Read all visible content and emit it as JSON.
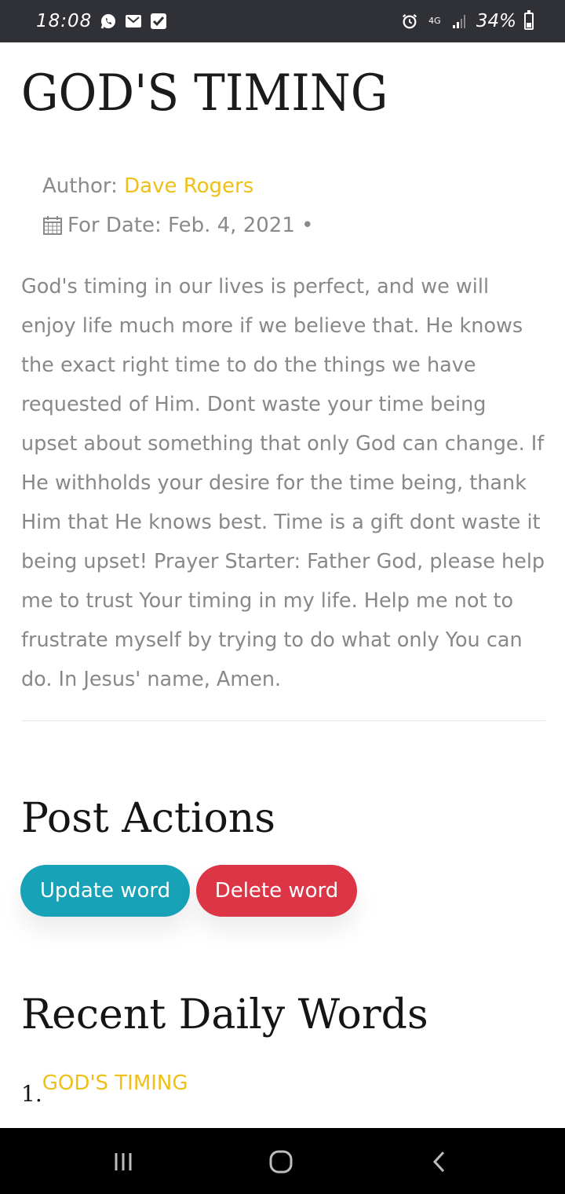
{
  "status_bar": {
    "time": "18:08",
    "network": "4G",
    "battery": "34%",
    "battery_level": 0.34,
    "icons": [
      "whatsapp-icon",
      "gmail-icon",
      "checkbox-icon",
      "alarm-icon",
      "signal-icon",
      "battery-icon"
    ]
  },
  "post": {
    "title": "GOD'S TIMING",
    "author_label": "Author:",
    "author_name": "Dave Rogers",
    "date_text": "For Date: Feb. 4, 2021 •",
    "body": "God's timing in our lives is perfect, and we will enjoy life much more if we believe that. He knows the exact right time to do the things we have requested of Him. Dont waste your time being upset about something that only God can change. If He withholds your desire for the time being, thank Him that He knows best. Time is a gift dont waste it being upset! Prayer Starter: Father God, please help me to trust Your timing in my life. Help me not to frustrate myself by trying to do what only You can do. In Jesus' name, Amen."
  },
  "post_actions": {
    "title": "Post Actions",
    "update_label": "Update word",
    "delete_label": "Delete word"
  },
  "recent": {
    "title": "Recent Daily Words",
    "items": [
      {
        "number": "1.",
        "label": "GOD'S TIMING"
      }
    ]
  },
  "colors": {
    "accent_yellow": "#efc018",
    "update_button": "#17a2b8",
    "delete_button": "#dc3545",
    "status_bar": "#2f3136"
  }
}
